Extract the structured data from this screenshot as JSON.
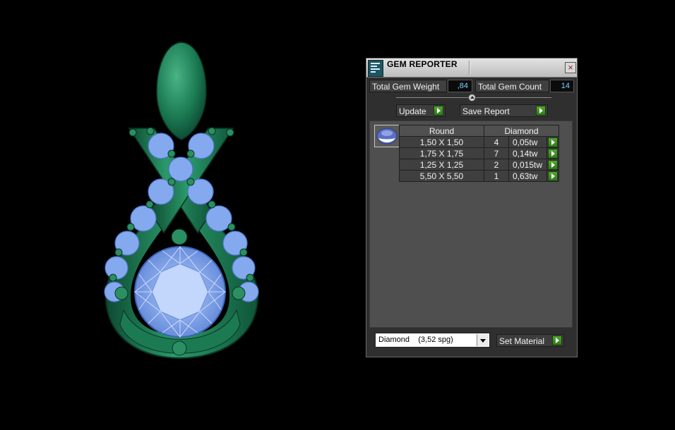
{
  "panel": {
    "title": "GEM REPORTER",
    "close_symbol": "×",
    "total_gem_weight_label": "Total Gem Weight",
    "total_gem_weight_value": ",84",
    "total_gem_count_label": "Total Gem Count",
    "total_gem_count_value": "14",
    "update_label": "Update",
    "save_report_label": "Save Report",
    "table": {
      "headers": [
        "Round",
        "Diamond"
      ],
      "rows": [
        {
          "size": "1,50 X 1,50",
          "count": "4",
          "weight": "0,05tw"
        },
        {
          "size": "1,75 X 1,75",
          "count": "7",
          "weight": "0,14tw"
        },
        {
          "size": "1,25 X 1,25",
          "count": "2",
          "weight": "0,015tw"
        },
        {
          "size": "5,50 X 5,50",
          "count": "1",
          "weight": "0,63tw"
        }
      ]
    },
    "material_select_value": "Diamond    (3,52 spg)",
    "set_material_label": "Set Material"
  },
  "icons": {
    "app": "gem-reporter-icon",
    "close": "close-icon",
    "gem": "round-gem-icon",
    "arrow": "green-arrow-icon",
    "dropdown": "chevron-down-icon"
  },
  "colors": {
    "metal": "#1f7a55",
    "gem": "#8fb4f5",
    "value_text": "#7dd0ff",
    "action_green": "#3f9428"
  }
}
